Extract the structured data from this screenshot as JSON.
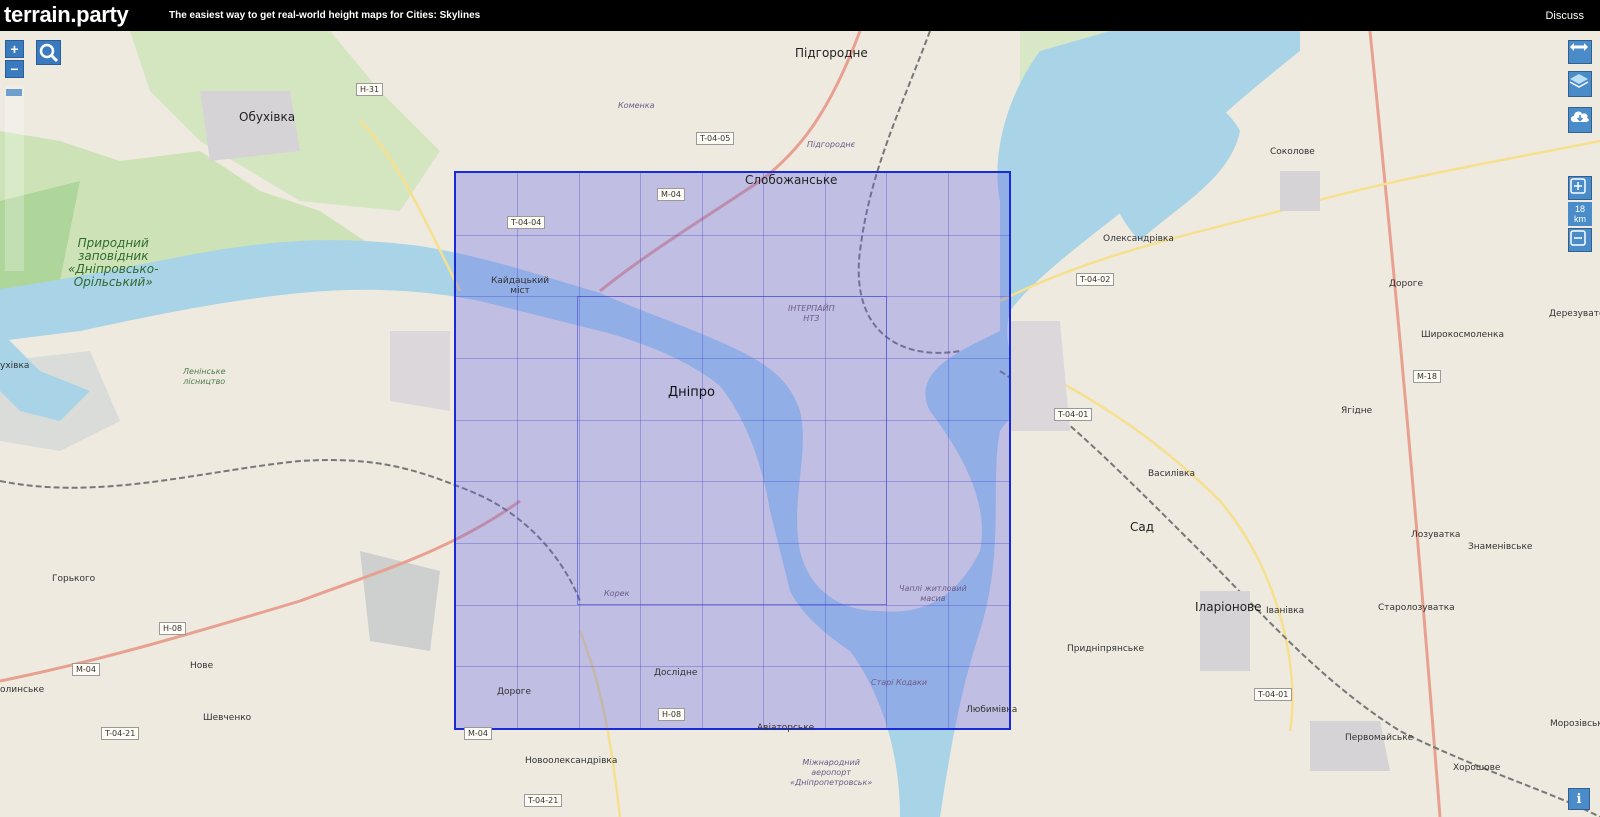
{
  "header": {
    "logo": "terrain.party",
    "tagline": "The easiest way to get real-world height maps for Cities: Skylines",
    "discuss_label": "Discuss"
  },
  "controls": {
    "zoom_in": "+",
    "zoom_out": "−",
    "size_value": "18",
    "size_unit": "km",
    "expand_icon": "arrows-horizontal-icon",
    "layers_icon": "layers-icon",
    "download_icon": "cloud-download-icon",
    "grow_icon": "plus-square-icon",
    "shrink_icon": "minus-square-icon",
    "info_label": "i"
  },
  "map": {
    "places": [
      {
        "id": "pidhorodne",
        "text": "Підгородне"
      },
      {
        "id": "obukhivka",
        "text": "Обухівка"
      },
      {
        "id": "reserve",
        "text": "Природний\nзаповідник\n«Дніпровсько-\nОрільський»"
      },
      {
        "id": "sloboz",
        "text": "Слобожанське"
      },
      {
        "id": "dnipro",
        "text": "Дніпро"
      },
      {
        "id": "kaidak",
        "text": "Кайдацький\nміст"
      },
      {
        "id": "sokolove",
        "text": "Соколове"
      },
      {
        "id": "oleks",
        "text": "Олександрівка"
      },
      {
        "id": "dorohe_e",
        "text": "Дороге"
      },
      {
        "id": "derezuvate",
        "text": "Дерезувате"
      },
      {
        "id": "shyroko",
        "text": "Широкосмоленка"
      },
      {
        "id": "yahidne",
        "text": "Ягідне"
      },
      {
        "id": "vasylivka",
        "text": "Василівка"
      },
      {
        "id": "sad",
        "text": "Сад"
      },
      {
        "id": "lozuvatka",
        "text": "Лозуватка"
      },
      {
        "id": "znamen",
        "text": "Знаменівське"
      },
      {
        "id": "ilar",
        "text": "Іларіонове"
      },
      {
        "id": "ivanivka",
        "text": "Іванівка"
      },
      {
        "id": "starolo",
        "text": "Старолозуватка"
      },
      {
        "id": "prydnipr",
        "text": "Придніпрянське"
      },
      {
        "id": "lyubymivka",
        "text": "Любимівка"
      },
      {
        "id": "morozivske",
        "text": "Морозівське"
      },
      {
        "id": "pervomaiske",
        "text": "Первомайське"
      },
      {
        "id": "khoroshove",
        "text": "Хорошове"
      },
      {
        "id": "horkoho",
        "text": "Горького"
      },
      {
        "id": "nove",
        "text": "Нове"
      },
      {
        "id": "shevchenko",
        "text": "Шевченко"
      },
      {
        "id": "dorohe_s",
        "text": "Дороге"
      },
      {
        "id": "dosl",
        "text": "Дослідне"
      },
      {
        "id": "aviator",
        "text": "Авіаторське"
      },
      {
        "id": "novooleks",
        "text": "Новоолександрівка"
      },
      {
        "id": "airport",
        "text": "Міжнародний\nаеропорт\n«Дніпропетровськ»"
      },
      {
        "id": "komenka",
        "text": "Коменка"
      },
      {
        "id": "pidhorodne_ap",
        "text": "Підгороднє"
      },
      {
        "id": "interpipe",
        "text": "ІНТЕРПАЙП\nНТЗ"
      },
      {
        "id": "lenin",
        "text": "Ленінське\nлісництво"
      },
      {
        "id": "korek",
        "text": "Корек"
      },
      {
        "id": "chapli",
        "text": "Чаплі житловий\nмасив"
      },
      {
        "id": "stari_kodaky",
        "text": "Старі Кодаки"
      },
      {
        "id": "ukhivka",
        "text": "ухівка"
      },
      {
        "id": "olynske",
        "text": "олинське"
      }
    ],
    "roads": [
      {
        "id": "h31",
        "text": "H-31"
      },
      {
        "id": "t0405",
        "text": "T-04-05"
      },
      {
        "id": "m04n",
        "text": "M-04"
      },
      {
        "id": "t0404",
        "text": "T-04-04"
      },
      {
        "id": "t0402",
        "text": "T-04-02"
      },
      {
        "id": "m18",
        "text": "M-18"
      },
      {
        "id": "t0401a",
        "text": "T-04-01"
      },
      {
        "id": "t0401b",
        "text": "T-04-01"
      },
      {
        "id": "h08w",
        "text": "H-08"
      },
      {
        "id": "m04w",
        "text": "M-04"
      },
      {
        "id": "t0421",
        "text": "T-04-21"
      },
      {
        "id": "h08s",
        "text": "H-08"
      },
      {
        "id": "m04s",
        "text": "M-04"
      },
      {
        "id": "t0421s",
        "text": "T-04-21"
      }
    ]
  }
}
